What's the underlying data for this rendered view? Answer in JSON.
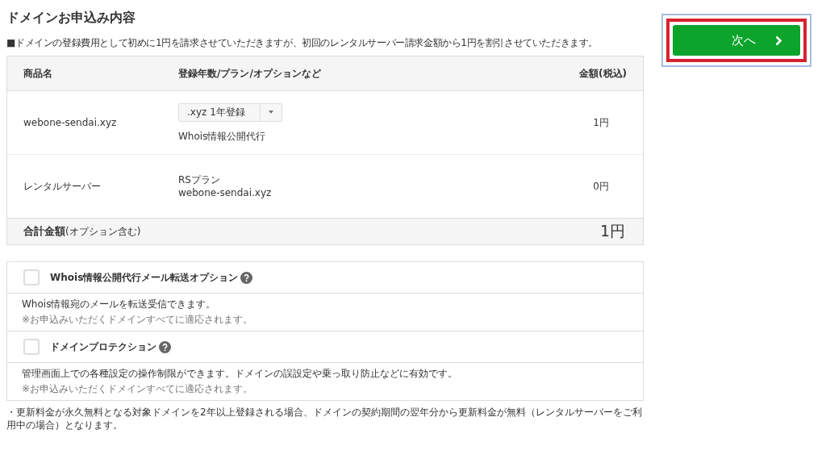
{
  "title": "ドメインお申込み内容",
  "notice": "■ドメインの登録費用として初めに1円を請求させていただきますが、初回のレンタルサーバー請求金額から1円を割引させていただきます。",
  "table": {
    "columns": [
      "商品名",
      "登録年数/プラン/オプションなど",
      "金額(税込)"
    ],
    "rows": [
      {
        "name": "webone-sendai.xyz",
        "kind": "select",
        "select_value": ".xyz 1年登録",
        "details": [
          "Whois情報公開代行"
        ],
        "price": "1円"
      },
      {
        "name": "レンタルサーバー",
        "kind": "text",
        "details": [
          "RSプラン",
          "webone-sendai.xyz"
        ],
        "price": "0円"
      }
    ],
    "total": {
      "label": "合計金額",
      "note": "(オプション含む)",
      "amount": "1円"
    }
  },
  "options": [
    {
      "label": "Whois情報公開代行メール転送オプション",
      "checked": false,
      "description": "Whois情報宛のメールを転送受信できます。",
      "note": "※お申込みいただくドメインすべてに適応されます。"
    },
    {
      "label": "ドメインプロテクション",
      "checked": false,
      "description": "管理画面上での各種設定の操作制限ができます。ドメインの誤設定や乗っ取り防止などに有効です。",
      "note": "※お申込みいただくドメインすべてに適応されます。"
    }
  ],
  "footnote": "・更新料金が永久無料となる対象ドメインを2年以上登録される場合、ドメインの契約期間の翌年分から更新料金が無料（レンタルサーバーをご利用中の場合）となります。",
  "next_button": {
    "label": "次へ",
    "highlighted": true
  }
}
